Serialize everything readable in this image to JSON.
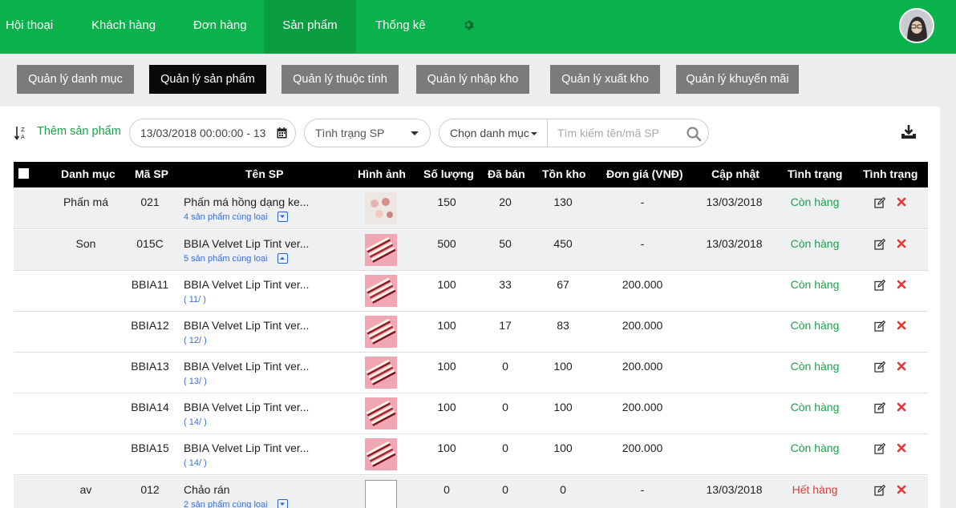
{
  "nav": {
    "items": [
      {
        "label": "Hội thoại",
        "active": false
      },
      {
        "label": "Khách hàng",
        "active": false
      },
      {
        "label": "Đơn hàng",
        "active": false
      },
      {
        "label": "Sản phẩm",
        "active": true
      },
      {
        "label": "Thống kê",
        "active": false
      }
    ],
    "settings_icon": "gear-icon",
    "avatar": "user-avatar"
  },
  "subtabs": [
    {
      "label": "Quản lý danh mục",
      "active": false
    },
    {
      "label": "Quản lý sản phẩm",
      "active": true
    },
    {
      "label": "Quản lý thuộc tính",
      "active": false
    },
    {
      "label": "Quản lý nhập kho",
      "active": false
    },
    {
      "label": "Quản lý xuất kho",
      "active": false
    },
    {
      "label": "Quản lý khuyến mãi",
      "active": false
    }
  ],
  "toolbar": {
    "sort_icon": "sort-az-icon",
    "add_product": "Thêm sản phẩm",
    "date_range": "13/03/2018 00:00:00 - 13",
    "status_select": "Tình trạng SP",
    "category_select": "Chọn danh mục",
    "search_placeholder": "Tìm kiếm tên/mã SP",
    "download_icon": "download-icon"
  },
  "table": {
    "headers": [
      "Danh mục",
      "Mã SP",
      "Tên SP",
      "Hình ảnh",
      "Số lượng",
      "Đã bán",
      "Tồn kho",
      "Đơn giá (VNĐ)",
      "Cập nhật",
      "Tình trạng",
      "Tình trạng"
    ],
    "rows": [
      {
        "category": "Phấn má",
        "code": "021",
        "name": "Phấn má hồng dạng ke...",
        "sub": "4 sản phẩm cùng loại",
        "expand": "down",
        "qty": "150",
        "sold": "20",
        "stock": "130",
        "price": "-",
        "updated": "13/03/2018",
        "status": "Còn hàng",
        "status_type": "ok",
        "parent": true,
        "img": "blush"
      },
      {
        "category": "Son",
        "code": "015C",
        "name": "BBIA Velvet Lip Tint ver...",
        "sub": "5 sản phẩm cùng loại",
        "expand": "up",
        "qty": "500",
        "sold": "50",
        "stock": "450",
        "price": "-",
        "updated": "13/03/2018",
        "status": "Còn hàng",
        "status_type": "ok",
        "parent": true,
        "img": "lip"
      },
      {
        "category": "",
        "code": "BBIA11",
        "name": "BBIA Velvet Lip Tint ver...",
        "sub": "( 11/ )",
        "expand": "",
        "qty": "100",
        "sold": "33",
        "stock": "67",
        "price": "200.000",
        "updated": "",
        "status": "Còn hàng",
        "status_type": "ok",
        "parent": false,
        "img": "lip"
      },
      {
        "category": "",
        "code": "BBIA12",
        "name": "BBIA Velvet Lip Tint ver...",
        "sub": "( 12/ )",
        "expand": "",
        "qty": "100",
        "sold": "17",
        "stock": "83",
        "price": "200.000",
        "updated": "",
        "status": "Còn hàng",
        "status_type": "ok",
        "parent": false,
        "img": "lip"
      },
      {
        "category": "",
        "code": "BBIA13",
        "name": "BBIA Velvet Lip Tint ver...",
        "sub": "( 13/ )",
        "expand": "",
        "qty": "100",
        "sold": "0",
        "stock": "100",
        "price": "200.000",
        "updated": "",
        "status": "Còn hàng",
        "status_type": "ok",
        "parent": false,
        "img": "lip"
      },
      {
        "category": "",
        "code": "BBIA14",
        "name": "BBIA Velvet Lip Tint ver...",
        "sub": "( 14/ )",
        "expand": "",
        "qty": "100",
        "sold": "0",
        "stock": "100",
        "price": "200.000",
        "updated": "",
        "status": "Còn hàng",
        "status_type": "ok",
        "parent": false,
        "img": "lip"
      },
      {
        "category": "",
        "code": "BBIA15",
        "name": "BBIA Velvet Lip Tint ver...",
        "sub": "( 14/ )",
        "expand": "",
        "qty": "100",
        "sold": "0",
        "stock": "100",
        "price": "200.000",
        "updated": "",
        "status": "Còn hàng",
        "status_type": "ok",
        "parent": false,
        "img": "lip"
      },
      {
        "category": "av",
        "code": "012",
        "name": "Chảo rán",
        "sub": "2 sản phẩm cùng loại",
        "expand": "down",
        "qty": "0",
        "sold": "0",
        "stock": "0",
        "price": "-",
        "updated": "13/03/2018",
        "status": "Hết hàng",
        "status_type": "out",
        "parent": true,
        "img": "broken"
      }
    ]
  },
  "colors": {
    "brand_green": "#0bb14a",
    "ok": "#1aa34a",
    "out": "#e53935",
    "link": "#3b6fd8"
  }
}
